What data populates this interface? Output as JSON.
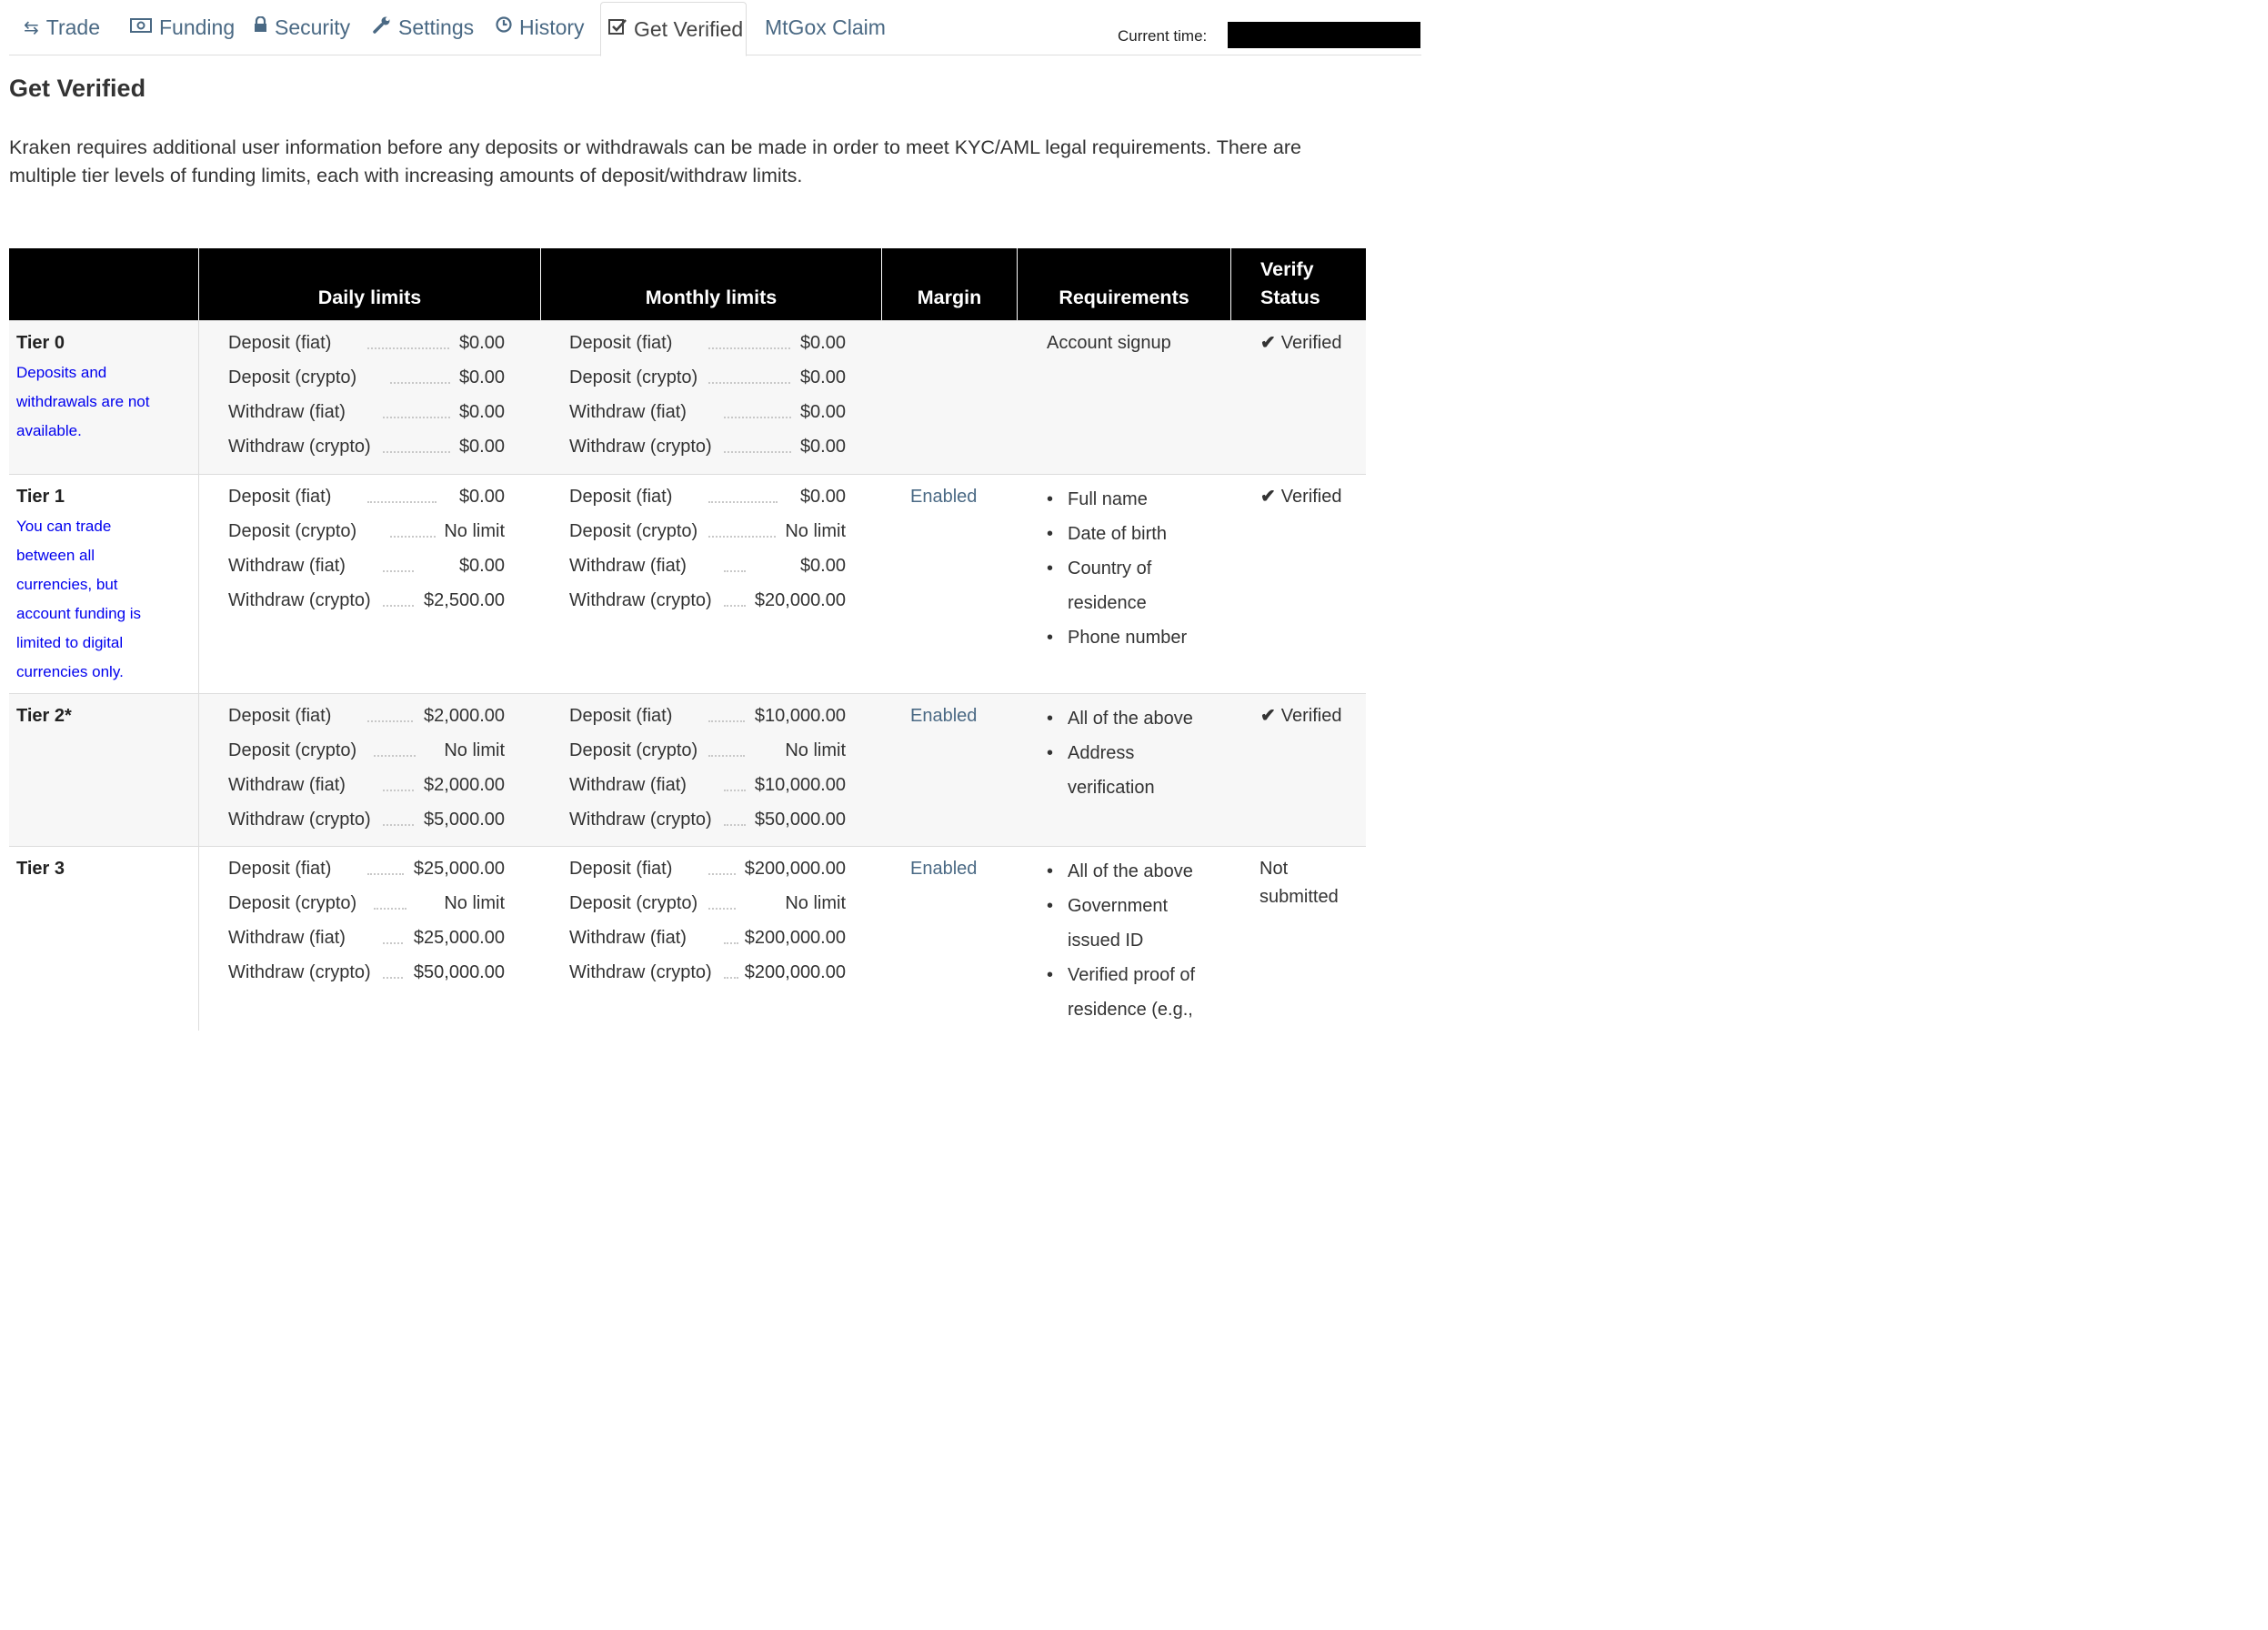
{
  "tabs": [
    {
      "label": "Trade",
      "icon": "retweet-icon"
    },
    {
      "label": "Funding",
      "icon": "money-icon"
    },
    {
      "label": "Security",
      "icon": "lock-icon"
    },
    {
      "label": "Settings",
      "icon": "wrench-icon"
    },
    {
      "label": "History",
      "icon": "clock-icon"
    },
    {
      "label": "Get Verified",
      "icon": "check-square-icon",
      "active": true
    },
    {
      "label": "MtGox Claim"
    }
  ],
  "current_time_label": "Current time:",
  "page_title": "Get Verified",
  "intro": "Kraken requires additional user information before any deposits or withdrawals can be made in order to meet KYC/AML legal requirements. There are multiple tier levels of funding limits, each with increasing amounts of deposit/withdraw limits.",
  "table": {
    "headers": {
      "daily": "Daily limits",
      "monthly": "Monthly limits",
      "margin": "Margin",
      "requirements": "Requirements",
      "status_line1": "Verify",
      "status_line2": "Status"
    },
    "rows": [
      {
        "tier": "Tier 0",
        "desc": "Deposits and withdrawals are not available.",
        "daily": [
          [
            "Deposit (fiat)",
            "$0.00"
          ],
          [
            "Deposit (crypto)",
            "$0.00"
          ],
          [
            "Withdraw (fiat)",
            "$0.00"
          ],
          [
            "Withdraw (crypto)",
            "$0.00"
          ]
        ],
        "monthly": [
          [
            "Deposit (fiat)",
            "$0.00"
          ],
          [
            "Deposit (crypto)",
            "$0.00"
          ],
          [
            "Withdraw (fiat)",
            "$0.00"
          ],
          [
            "Withdraw (crypto)",
            "$0.00"
          ]
        ],
        "margin": "",
        "requirement_text": "Account signup",
        "status": "Verified"
      },
      {
        "tier": "Tier 1",
        "desc": "You can trade between all currencies, but account funding is limited to digital currencies only.",
        "daily": [
          [
            "Deposit (fiat)",
            "$0.00"
          ],
          [
            "Deposit (crypto)",
            "No limit"
          ],
          [
            "Withdraw (fiat)",
            "$0.00"
          ],
          [
            "Withdraw (crypto)",
            "$2,500.00"
          ]
        ],
        "monthly": [
          [
            "Deposit (fiat)",
            "$0.00"
          ],
          [
            "Deposit (crypto)",
            "No limit"
          ],
          [
            "Withdraw (fiat)",
            "$0.00"
          ],
          [
            "Withdraw (crypto)",
            "$20,000.00"
          ]
        ],
        "margin": "Enabled",
        "requirements": [
          "Full name",
          "Date of birth",
          "Country of residence",
          "Phone number"
        ],
        "status": "Verified"
      },
      {
        "tier": "Tier 2*",
        "desc": "",
        "daily": [
          [
            "Deposit (fiat)",
            "$2,000.00"
          ],
          [
            "Deposit (crypto)",
            "No limit"
          ],
          [
            "Withdraw (fiat)",
            "$2,000.00"
          ],
          [
            "Withdraw (crypto)",
            "$5,000.00"
          ]
        ],
        "monthly": [
          [
            "Deposit (fiat)",
            "$10,000.00"
          ],
          [
            "Deposit (crypto)",
            "No limit"
          ],
          [
            "Withdraw (fiat)",
            "$10,000.00"
          ],
          [
            "Withdraw (crypto)",
            "$50,000.00"
          ]
        ],
        "margin": "Enabled",
        "requirements": [
          "All of the above",
          "Address verification"
        ],
        "status": "Verified"
      },
      {
        "tier": "Tier 3",
        "desc": "",
        "daily": [
          [
            "Deposit (fiat)",
            "$25,000.00"
          ],
          [
            "Deposit (crypto)",
            "No limit"
          ],
          [
            "Withdraw (fiat)",
            "$25,000.00"
          ],
          [
            "Withdraw (crypto)",
            "$50,000.00"
          ]
        ],
        "monthly": [
          [
            "Deposit (fiat)",
            "$200,000.00"
          ],
          [
            "Deposit (crypto)",
            "No limit"
          ],
          [
            "Withdraw (fiat)",
            "$200,000.00"
          ],
          [
            "Withdraw (crypto)",
            "$200,000.00"
          ]
        ],
        "margin": "Enabled",
        "requirements": [
          "All of the above",
          "Government issued ID",
          "Verified proof of residence (e.g.,"
        ],
        "status": "Not submitted"
      }
    ]
  },
  "colors": {
    "link": "#4a6984",
    "desc": "#0000ee",
    "header_bg": "#000000",
    "row_shade": "#f7f7f7"
  }
}
